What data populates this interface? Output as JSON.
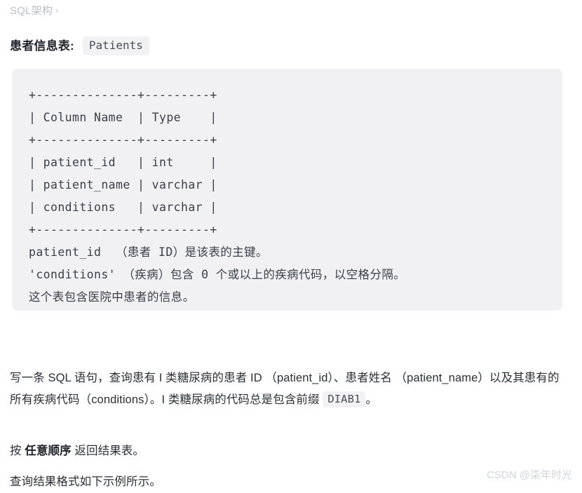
{
  "breadcrumb": {
    "label": "SQL架构",
    "separator": "›"
  },
  "title": {
    "label": "患者信息表:",
    "table_name": "Patients"
  },
  "schema_block": {
    "ascii_table": "+--------------+---------+\n| Column Name  | Type    |\n+--------------+---------+\n| patient_id   | int     |\n| patient_name | varchar |\n| conditions   | varchar |\n+--------------+---------+",
    "notes": [
      "patient_id  （患者 ID）是该表的主键。",
      "'conditions' （疾病）包含 0 个或以上的疾病代码，以空格分隔。",
      "这个表包含医院中患者的信息。"
    ],
    "columns": [
      {
        "name": "patient_id",
        "type": "int"
      },
      {
        "name": "patient_name",
        "type": "varchar"
      },
      {
        "name": "conditions",
        "type": "varchar"
      }
    ],
    "headers": [
      "Column Name",
      "Type"
    ]
  },
  "task": {
    "part1": "写一条 SQL 语句，查询患有 I 类糖尿病的患者 ID （patient_id）、患者姓名 （patient_name）以及其患有的所有疾病代码（conditions）。I 类糖尿病的代码总是包含前缀",
    "code": "DIAB1",
    "part2": "。"
  },
  "order_note": {
    "prefix": "按",
    "emphasis": "任意顺序",
    "suffix": "返回结果表。"
  },
  "format_note": {
    "text": "查询结果格式如下示例所示。"
  },
  "watermark": {
    "text": "CSDN @柒年时光"
  },
  "colors": {
    "code_block_bg": "#f1f1f4",
    "inline_code_bg": "#f2f2f4",
    "body_text": "#2b3137",
    "breadcrumb_text": "#b9bec6",
    "watermark_text": "#d2d5da",
    "page_bg": "#ffffff"
  }
}
